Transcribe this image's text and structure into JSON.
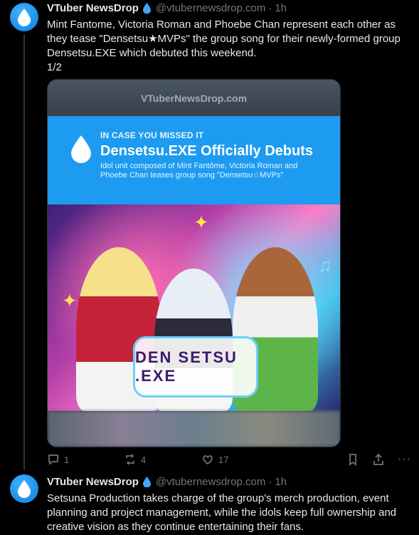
{
  "post1": {
    "author": "VTuber NewsDrop",
    "handle": "@vtubernewsdrop.com",
    "separator": "·",
    "time": "1h",
    "more_label": "···",
    "text": "Mint Fantome, Victoria Roman and Phoebe Chan represent each other as they tease \"Densetsu★MVPs\" the group song for their newly-formed group Densetsu.EXE which debuted this weekend.\n1/2",
    "media": {
      "watermark": "VTuberNewsDrop.com",
      "kicker": "IN CASE YOU MISSED IT",
      "headline": "Densetsu.EXE Officially Debuts",
      "subheadline": "Idol unit composed of Mint Fantôme, Victoria Roman and Phoebe Chan teases group song \"Densetsu☆MVPs\"",
      "logo_text": "DEN SETSU .EXE"
    },
    "stats": {
      "replies": "1",
      "reposts": "4",
      "likes": "17"
    }
  },
  "post2": {
    "author": "VTuber NewsDrop",
    "handle": "@vtubernewsdrop.com",
    "separator": "·",
    "time": "1h",
    "text": "Setsuna Production takes charge of the group's merch production, event planning and project management, while the idols keep full ownership and creative vision as they continue entertaining their fans."
  },
  "icons": [
    "droplet-avatar-icon",
    "verified-droplet-icon",
    "reply-icon",
    "repost-icon",
    "like-icon",
    "bookmark-icon",
    "share-icon",
    "more-icon"
  ],
  "colors": {
    "accent": "#1d9bf0",
    "text": "#e7e9ea",
    "muted": "#71767b",
    "background": "#000000"
  }
}
